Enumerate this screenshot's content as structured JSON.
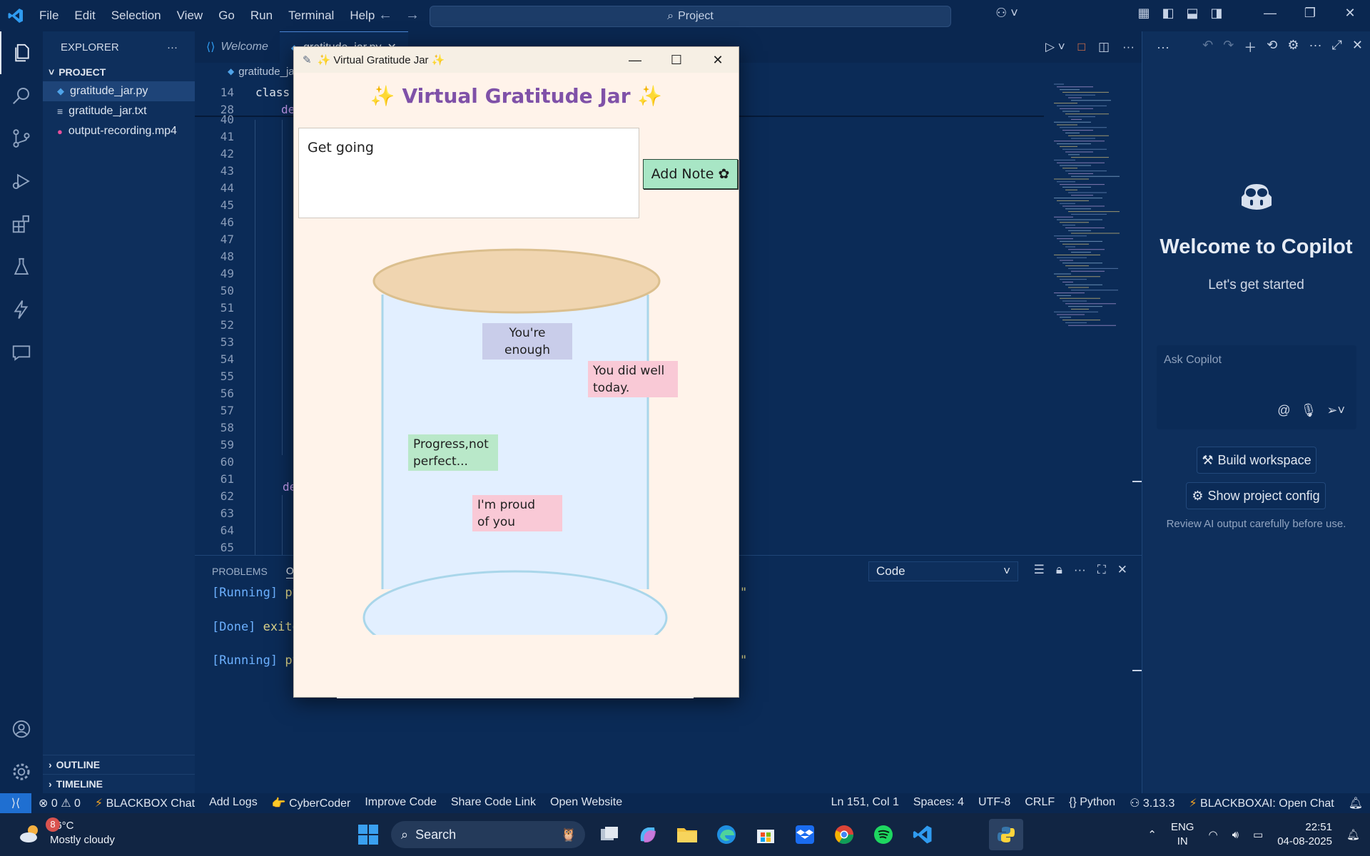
{
  "titlebar": {
    "menu": [
      "File",
      "Edit",
      "Selection",
      "View",
      "Go",
      "Run",
      "Terminal",
      "Help"
    ],
    "command_center": "Project"
  },
  "sidebar": {
    "title": "EXPLORER",
    "project": "PROJECT",
    "files": [
      {
        "name": "gratitude_jar.py",
        "icon": "python-file-icon",
        "active": true
      },
      {
        "name": "gratitude_jar.txt",
        "icon": "text-file-icon"
      },
      {
        "name": "output-recording.mp4",
        "icon": "media-file-icon"
      }
    ],
    "outline": "OUTLINE",
    "timeline": "TIMELINE"
  },
  "editor": {
    "tabs": [
      {
        "label": "Welcome"
      },
      {
        "label": "gratitude_jar.py"
      }
    ],
    "breadcrumb": "gratitude_jar",
    "sticky": [
      {
        "line": "14",
        "code": "class"
      },
      {
        "line": "28",
        "code": "de"
      }
    ],
    "lines": [
      "40",
      "41",
      "42",
      "43",
      "44",
      "45",
      "46",
      "47",
      "48",
      "49",
      "50",
      "51",
      "52",
      "53",
      "54",
      "55",
      "56",
      "57",
      "58",
      "59",
      "60",
      "61",
      "62",
      "63",
      "64",
      "65"
    ],
    "def_line": "de"
  },
  "panel": {
    "tabs": [
      "PROBLEMS",
      "OU"
    ],
    "select": "Code",
    "output": [
      {
        "tag": "[Running]",
        "text": "py"
      },
      {
        "tag": "[Done]",
        "text": "exite"
      },
      {
        "tag": "[Running]",
        "text": "py"
      }
    ],
    "tail_mark": "\""
  },
  "copilot": {
    "title": "Welcome to Copilot",
    "subtitle": "Let's get started",
    "placeholder": "Ask Copilot",
    "build_button": "Build workspace",
    "config_button": "Show project config",
    "note": "Review AI output carefully before use."
  },
  "statusbar": {
    "errors": "0",
    "warnings": "0",
    "left": [
      "BLACKBOX Chat",
      "Add Logs",
      "CyberCoder",
      "Improve Code",
      "Share Code Link",
      "Open Website"
    ],
    "position": "Ln 151, Col 1",
    "spaces": "Spaces: 4",
    "encoding": "UTF-8",
    "eol": "CRLF",
    "language": "Python",
    "version": "3.13.3",
    "blackbox": "BLACKBOXAI: Open Chat"
  },
  "taskbar": {
    "weather_temp": "26°C",
    "weather_desc": "Mostly cloudy",
    "weather_badge": "8",
    "search": "Search",
    "lang": "ENG",
    "region": "IN",
    "time": "22:51",
    "date": "04-08-2025"
  },
  "app": {
    "window_title": "✨ Virtual Gratitude Jar ✨",
    "heading": "✨ Virtual Gratitude Jar ✨",
    "input_text": "Get going",
    "add_button": "Add Note ✿",
    "notes": [
      {
        "text1": "You're",
        "text2": "enough",
        "color": "#c9cdea"
      },
      {
        "text1": "You did well",
        "text2": "today.",
        "color": "#f9c9d6"
      },
      {
        "text1": "Progress,not",
        "text2": "perfect...",
        "color": "#b9e8c9"
      },
      {
        "text1": "I'm proud",
        "text2": "of you",
        "color": "#f9c9d6"
      }
    ],
    "colors": {
      "heading": "#7f51a8",
      "jar_lid": "#f0d5b0",
      "jar_body": "#e2efff",
      "jar_outline": "#a9d6ea",
      "background": "#fff3ea"
    }
  }
}
